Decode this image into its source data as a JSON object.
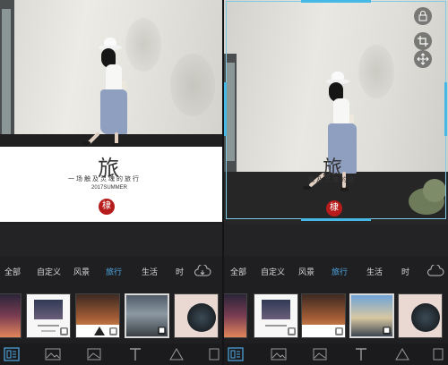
{
  "left_panel": {
    "template": {
      "title_char": "旅",
      "subtitle": "一场触及灵魂的旅行",
      "year": "2017SUMMER",
      "seal_char": "棣"
    }
  },
  "right_panel": {
    "overlay": {
      "title_char": "旅",
      "subtitle": "触及灵魂的旅",
      "seal_char": "棣"
    },
    "tools": {
      "lock_icon": "lock-icon",
      "crop_icon": "crop-icon",
      "move_icon": "move-icon"
    }
  },
  "categories": {
    "left": [
      "全部",
      "自定义",
      "风景",
      "旅行",
      "生活",
      "时"
    ],
    "right": [
      "全部",
      "自定义",
      "风景",
      "旅行",
      "生活",
      "时"
    ],
    "active": "旅行"
  },
  "toolbar_icons": [
    "template-icon",
    "image-icon",
    "photo-icon",
    "text-icon",
    "shape-icon",
    "more-icon"
  ],
  "colors": {
    "accent": "#4fa8e4",
    "crop_handle": "#45b8e6",
    "seal": "#b71c1c",
    "background": "#1f1f21"
  }
}
